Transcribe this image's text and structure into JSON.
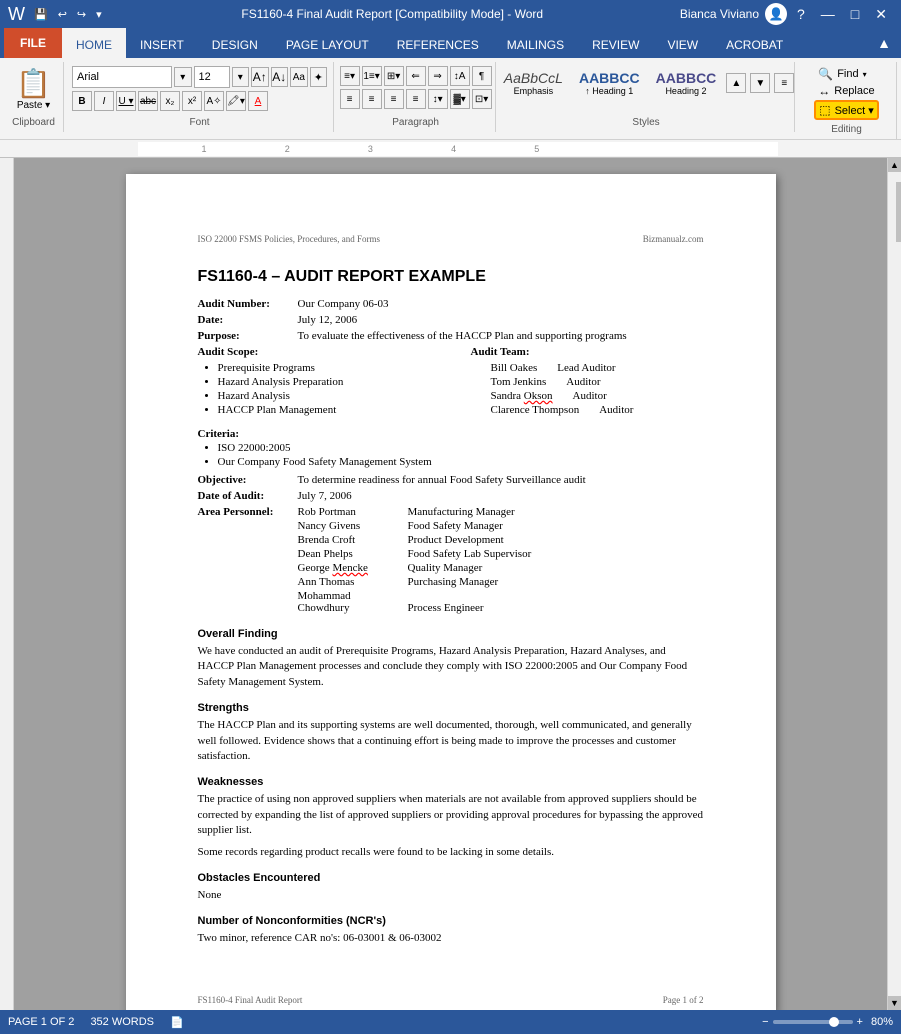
{
  "titleBar": {
    "title": "FS1160-4 Final Audit Report [Compatibility Mode] - Word",
    "quickAccess": [
      "💾",
      "↩",
      "↪",
      "▾"
    ],
    "windowControls": [
      "?",
      "—",
      "□",
      "✕"
    ]
  },
  "tabs": {
    "file": "FILE",
    "items": [
      "HOME",
      "INSERT",
      "DESIGN",
      "PAGE LAYOUT",
      "REFERENCES",
      "MAILINGS",
      "REVIEW",
      "VIEW",
      "ACROBAT"
    ]
  },
  "ribbon": {
    "clipboard": {
      "label": "Clipboard",
      "paste": "Paste"
    },
    "font": {
      "label": "Font",
      "name": "Arial",
      "size": "12",
      "bold": "B",
      "italic": "I",
      "underline": "U",
      "strikethrough": "abc",
      "subscript": "x₂",
      "superscript": "x²"
    },
    "paragraph": {
      "label": "Paragraph"
    },
    "styles": {
      "label": "Styles",
      "items": [
        {
          "name": "Emphasis",
          "preview": "AaBbCcL"
        },
        {
          "name": "Heading 1",
          "preview": "AABBCC"
        },
        {
          "name": "Heading 2",
          "preview": "AABBCC"
        }
      ]
    },
    "editing": {
      "label": "Editing",
      "find": "Find",
      "replace": "Replace",
      "select": "Select ▾"
    }
  },
  "document": {
    "header_left": "ISO 22000 FSMS Policies, Procedures, and Forms",
    "header_right": "Bizmanualz.com",
    "title": "FS1160-4 – AUDIT REPORT EXAMPLE",
    "auditNumber": "Our Company 06-03",
    "date": "July 12, 2006",
    "purpose": "To evaluate the effectiveness of the HACCP Plan and supporting programs",
    "auditScope": {
      "label": "Audit Scope:",
      "items": [
        "Prerequisite Programs",
        "Hazard Analysis Preparation",
        "Hazard Analysis",
        "HACCP Plan Management"
      ]
    },
    "auditTeam": {
      "label": "Audit Team:",
      "members": [
        {
          "name": "Bill Oakes",
          "role": "Lead Auditor"
        },
        {
          "name": "Tom Jenkins",
          "role": "Auditor"
        },
        {
          "name": "Sandra Okson",
          "role": "Auditor"
        },
        {
          "name": "Clarence Thompson",
          "role": "Auditor"
        }
      ]
    },
    "criteria": {
      "label": "Criteria:",
      "items": [
        "ISO 22000:2005",
        "Our Company Food Safety Management System"
      ]
    },
    "objective": {
      "label": "Objective:",
      "value": "To determine readiness for annual Food Safety Surveillance audit"
    },
    "dateOfAudit": {
      "label": "Date of Audit:",
      "value": "July 7, 2006"
    },
    "areaPersonnel": {
      "label": "Area Personnel:",
      "people": [
        {
          "name": "Rob Portman",
          "role": "Manufacturing Manager"
        },
        {
          "name": "Nancy Givens",
          "role": "Food Safety Manager"
        },
        {
          "name": "Brenda Croft",
          "role": "Product Development"
        },
        {
          "name": "Dean Phelps",
          "role": "Food Safety Lab Supervisor"
        },
        {
          "name": "George Mencke",
          "role": "Quality Manager"
        },
        {
          "name": "Ann Thomas",
          "role": "Purchasing Manager"
        },
        {
          "name": "Mohammad Chowdhury",
          "role": "Process Engineer"
        }
      ]
    },
    "overallFinding": {
      "title": "Overall Finding",
      "text": "We have conducted an audit of Prerequisite Programs, Hazard Analysis Preparation, Hazard Analyses, and HACCP Plan Management processes and conclude they comply with ISO 22000:2005 and Our Company Food Safety Management System."
    },
    "strengths": {
      "title": "Strengths",
      "text": "The HACCP Plan and its supporting systems are well documented, thorough, well communicated, and generally well followed. Evidence shows that a continuing effort is being made to improve the processes and customer satisfaction."
    },
    "weaknesses": {
      "title": "Weaknesses",
      "text1": "The practice of using non approved suppliers when materials are not available from approved suppliers should be corrected by expanding the list of approved suppliers or providing approval procedures for bypassing the approved supplier list.",
      "text2": "Some records regarding product recalls were found to be lacking in some details."
    },
    "obstacles": {
      "title": "Obstacles Encountered",
      "text": "None"
    },
    "nonconformities": {
      "title": "Number of Nonconformities (NCR's)",
      "text": "Two minor, reference CAR no's: 06-03001 & 06-03002"
    },
    "footer_left": "FS1160-4 Final Audit Report",
    "footer_right": "Page 1 of 2"
  },
  "statusBar": {
    "page": "PAGE 1 OF 2",
    "words": "352 WORDS",
    "zoom": "80%",
    "viewMode": "📄"
  }
}
